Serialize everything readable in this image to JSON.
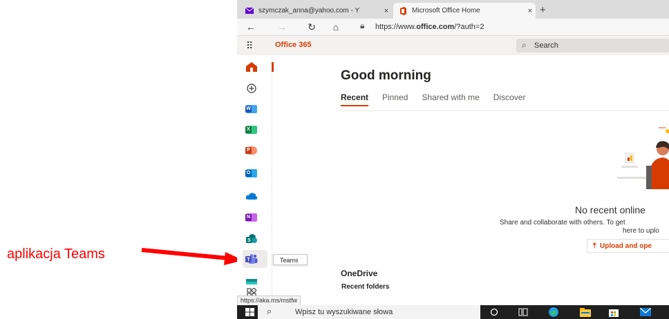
{
  "annotation": {
    "label": "aplikacja Teams"
  },
  "browser": {
    "tabs": [
      {
        "title": "szymczak_anna@yahoo.com - Y",
        "close": "×",
        "active": false
      },
      {
        "title": "Microsoft Office Home",
        "close": "×",
        "active": true
      }
    ],
    "new_tab": "+",
    "url_prefix": "https://www.",
    "url_domain": "office.com",
    "url_suffix": "/?auth=2",
    "status_url": "https://aka.ms/mstfw"
  },
  "office_header": {
    "brand": "Office 365",
    "search_placeholder": "Search"
  },
  "rail": {
    "items": [
      "home",
      "create",
      "word",
      "excel",
      "powerpoint",
      "outlook",
      "onedrive",
      "onenote",
      "sharepoint",
      "teams",
      "sway",
      "all-apps"
    ],
    "tooltip": "Teams"
  },
  "main": {
    "greeting": "Good morning",
    "tabs": [
      "Recent",
      "Pinned",
      "Shared with me",
      "Discover"
    ],
    "empty_title": "No recent online",
    "empty_sub1": "Share and collaborate with others. To get",
    "empty_sub2": "here to uplo",
    "upload_label": "Upload and ope",
    "upload_icon": "⤒",
    "onedrive": "OneDrive",
    "recent_folders": "Recent folders"
  },
  "taskbar": {
    "search_placeholder": "Wpisz tu wyszukiwane słowa"
  },
  "colors": {
    "accent": "#d83b01",
    "annotation": "#ff0000"
  }
}
